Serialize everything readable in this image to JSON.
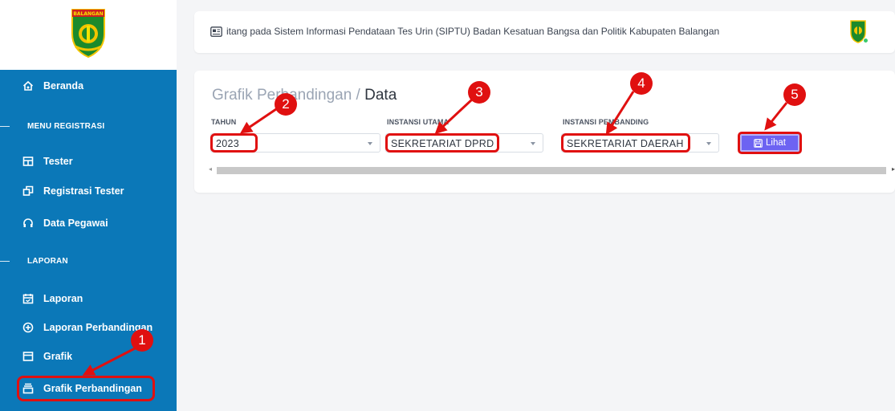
{
  "app": {
    "name": "SIPTU",
    "logo_text": "BALANGAN"
  },
  "sidebar": {
    "items": [
      {
        "label": "Beranda",
        "icon": "home-icon"
      },
      {
        "label": "MENU REGISTRASI",
        "type": "section"
      },
      {
        "label": "Tester",
        "icon": "table-icon"
      },
      {
        "label": "Registrasi Tester",
        "icon": "copy-icon"
      },
      {
        "label": "Data Pegawai",
        "icon": "headset-icon"
      },
      {
        "label": "LAPORAN",
        "type": "section"
      },
      {
        "label": "Laporan",
        "icon": "calendar-icon"
      },
      {
        "label": "Laporan Perbandingan",
        "icon": "compare-icon"
      },
      {
        "label": "Grafik",
        "icon": "window-icon"
      },
      {
        "label": "Grafik Perbandingan",
        "icon": "layers-icon",
        "active": true
      }
    ]
  },
  "topbar": {
    "marquee_text": "itang pada Sistem Informasi Pendataan Tes Urin (SIPTU) Badan Kesatuan Bangsa dan Politik Kabupaten Balangan"
  },
  "page": {
    "breadcrumb_parent": "Grafik Perbandingan /",
    "breadcrumb_current": "Data"
  },
  "filters": {
    "tahun": {
      "label": "TAHUN",
      "value": "2023"
    },
    "instansi_utama": {
      "label": "INSTANSI UTAMA",
      "value": "SEKRETARIAT DPRD"
    },
    "instansi_pembanding": {
      "label": "INSTANSI PEMBANDING",
      "value": "SEKRETARIAT DAERAH"
    }
  },
  "buttons": {
    "lihat": "Lihat"
  },
  "callouts": [
    "1",
    "2",
    "3",
    "4",
    "5"
  ],
  "colors": {
    "sidebar": "#0b78b8",
    "annotation": "#e01010",
    "button": "#6d63f2"
  }
}
